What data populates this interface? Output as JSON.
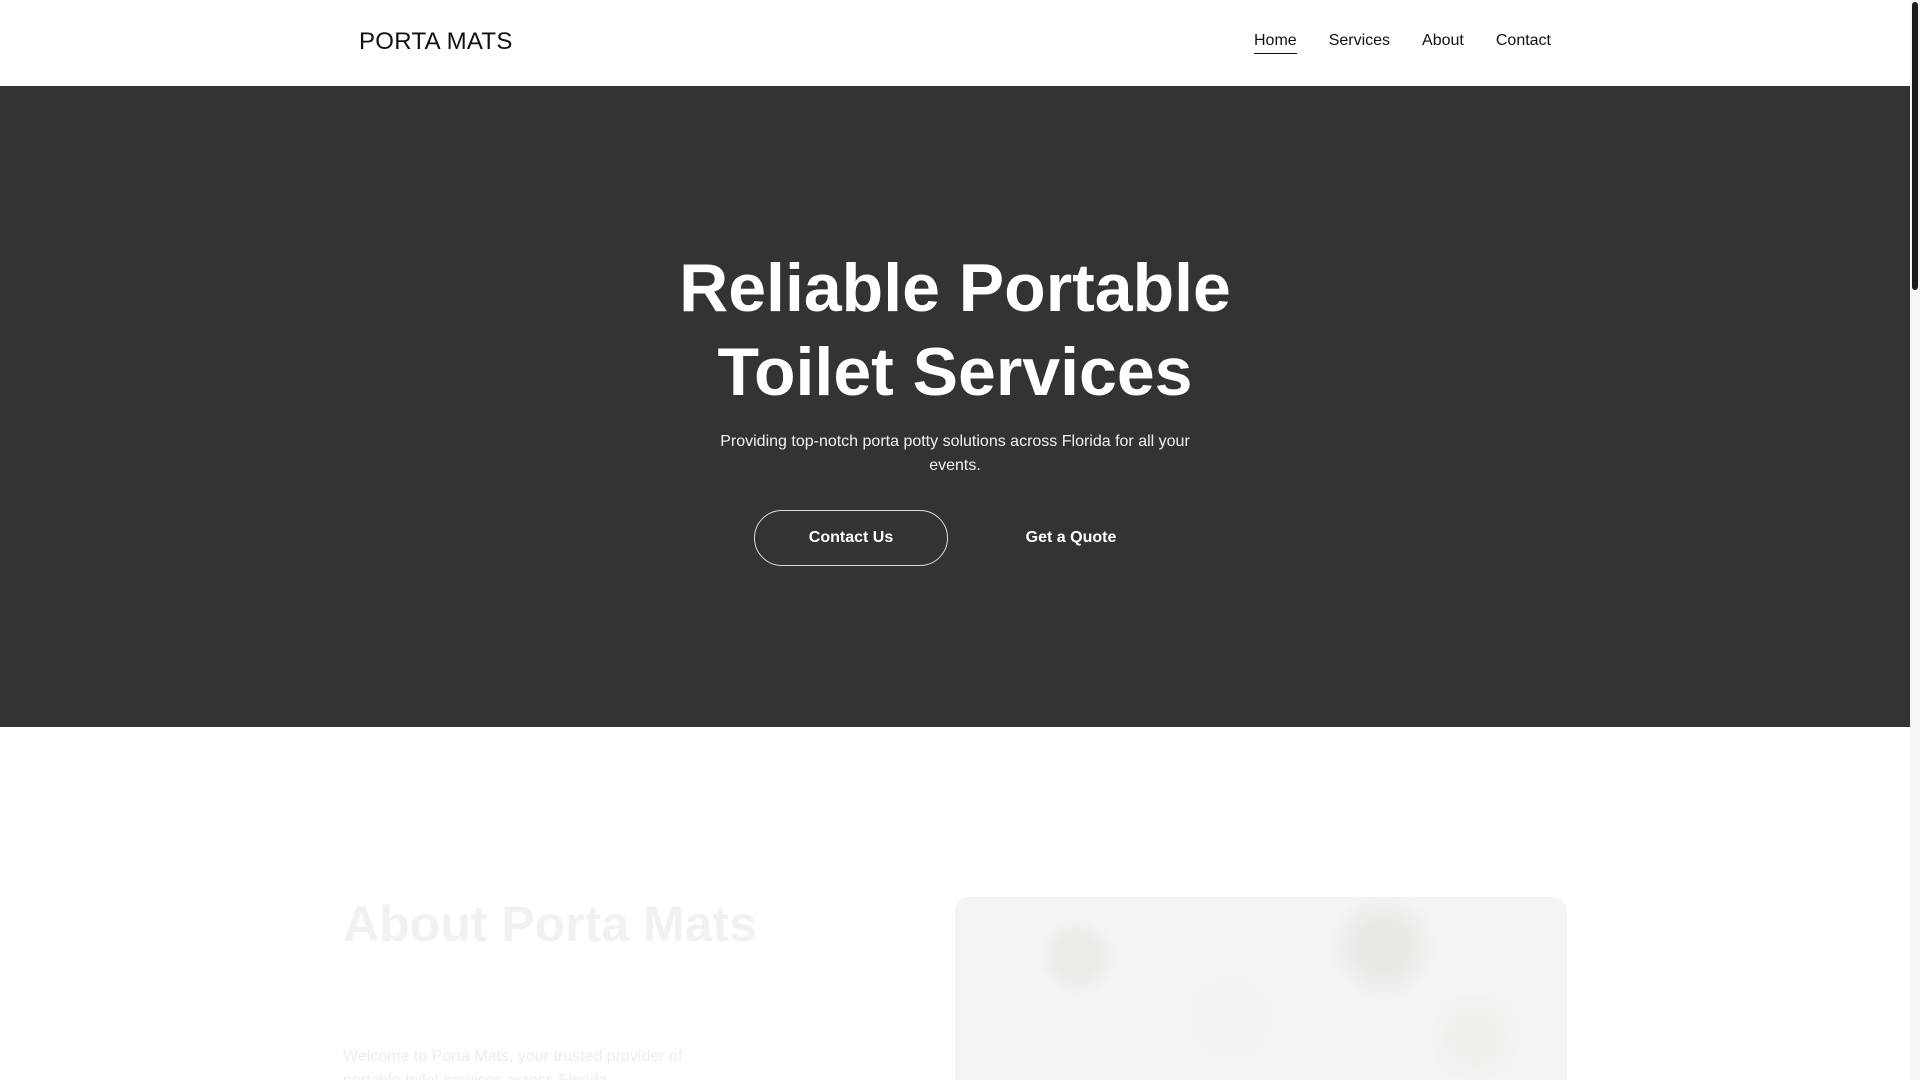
{
  "brand": {
    "logo_text": "PORTA MATS"
  },
  "nav": {
    "items": [
      {
        "label": "Home",
        "active": true
      },
      {
        "label": "Services",
        "active": false
      },
      {
        "label": "About",
        "active": false
      },
      {
        "label": "Contact",
        "active": false
      }
    ]
  },
  "hero": {
    "title": "Reliable Portable Toilet Services",
    "subtitle": "Providing top-notch porta potty solutions across Florida for all your events.",
    "primary_button": "Contact Us",
    "secondary_button": "Get a Quote"
  },
  "about": {
    "title": "About Porta Mats",
    "text": "Welcome to Porta Mats, your trusted provider of portable toilet services across Florida."
  },
  "colors": {
    "hero_bg": "#333333",
    "header_bg": "#ffffff",
    "text_dark": "#111111",
    "text_light": "#ffffff"
  }
}
